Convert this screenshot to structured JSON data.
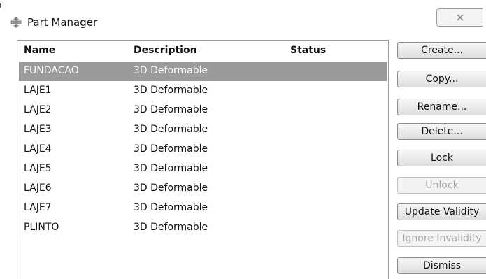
{
  "window": {
    "title": "Part Manager"
  },
  "icons": {
    "app": "part-manager-icon",
    "close": "close-icon"
  },
  "table": {
    "columns": [
      "Name",
      "Description",
      "Status"
    ],
    "rows": [
      {
        "name": "FUNDACAO",
        "description": "3D Deformable",
        "status": "",
        "selected": true
      },
      {
        "name": "LAJE1",
        "description": "3D Deformable",
        "status": ""
      },
      {
        "name": "LAJE2",
        "description": "3D Deformable",
        "status": ""
      },
      {
        "name": "LAJE3",
        "description": "3D Deformable",
        "status": ""
      },
      {
        "name": "LAJE4",
        "description": "3D Deformable",
        "status": ""
      },
      {
        "name": "LAJE5",
        "description": "3D Deformable",
        "status": ""
      },
      {
        "name": "LAJE6",
        "description": "3D Deformable",
        "status": ""
      },
      {
        "name": "LAJE7",
        "description": "3D Deformable",
        "status": ""
      },
      {
        "name": "PLINTO",
        "description": "3D Deformable",
        "status": ""
      }
    ]
  },
  "buttons": {
    "create": "Create...",
    "copy": "Copy...",
    "rename": "Rename...",
    "delete": "Delete...",
    "lock": "Lock",
    "unlock": "Unlock",
    "update_validity": "Update Validity",
    "ignore_invalidity": "Ignore Invalidity",
    "dismiss": "Dismiss"
  },
  "colors": {
    "selection": "#9b9b9b",
    "disabled_text": "#a9a9a9"
  }
}
